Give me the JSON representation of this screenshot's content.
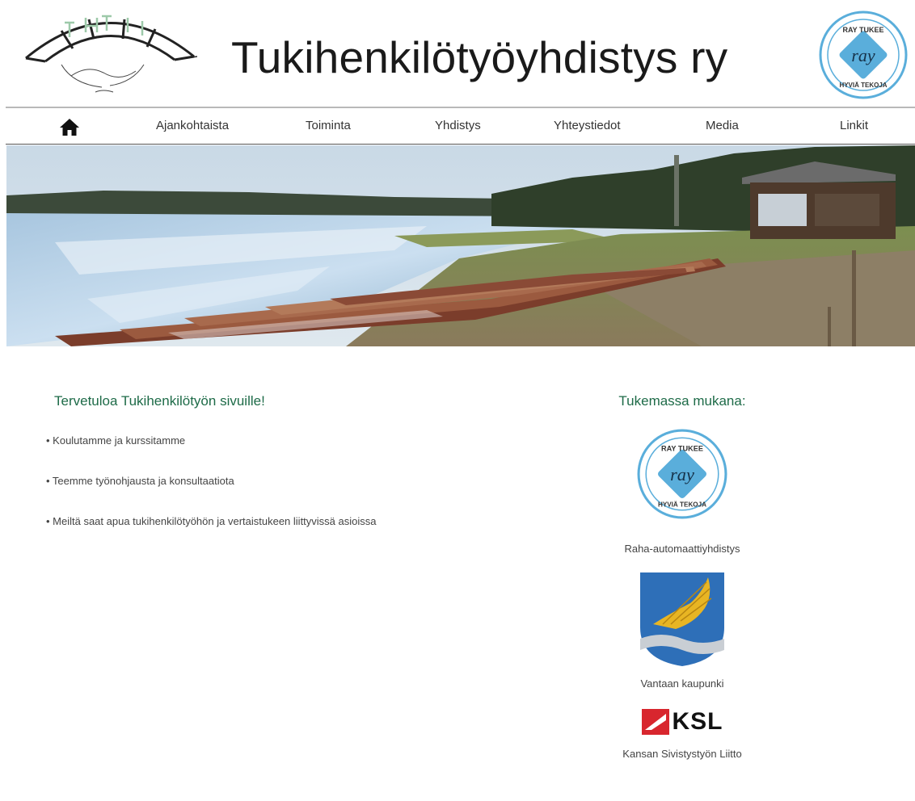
{
  "header": {
    "title": "Tukihenkilötyöyhdistys ry",
    "ray_badge": {
      "top": "RAY TUKEE",
      "center": "ray",
      "bottom": "HYVIÄ TEKOJA"
    }
  },
  "nav": {
    "home_icon": "home-icon",
    "items": [
      {
        "label": "Ajankohtaista"
      },
      {
        "label": "Toiminta"
      },
      {
        "label": "Yhdistys"
      },
      {
        "label": "Yhteystiedot"
      },
      {
        "label": "Media"
      },
      {
        "label": "Linkit"
      }
    ]
  },
  "main": {
    "heading": "Tervetuloa Tukihenkilötyön sivuille!",
    "bullets": [
      "• Koulutamme ja kurssitamme",
      "• Teemme työnohjausta ja konsultaatiota",
      "• Meiltä saat apua tukihenkilötyöhön ja vertaistukeen liittyvissä asioissa"
    ]
  },
  "sidebar": {
    "heading": "Tukemassa mukana:",
    "supporters": [
      {
        "name": "Raha-automaattiyhdistys",
        "logo": "ray-logo"
      },
      {
        "name": "Vantaan kaupunki",
        "logo": "vantaa-coat-of-arms"
      },
      {
        "name": "Kansan Sivistystyön Liitto",
        "logo": "ksl-logo",
        "logo_text": "KSL"
      }
    ]
  },
  "colors": {
    "accent_green": "#1e6b48",
    "ray_blue": "#5aaedb",
    "vantaa_blue": "#2e6fb8",
    "vantaa_gold": "#e8b523",
    "ksl_red": "#d8262e",
    "rule_gray": "#b9b9b9"
  }
}
